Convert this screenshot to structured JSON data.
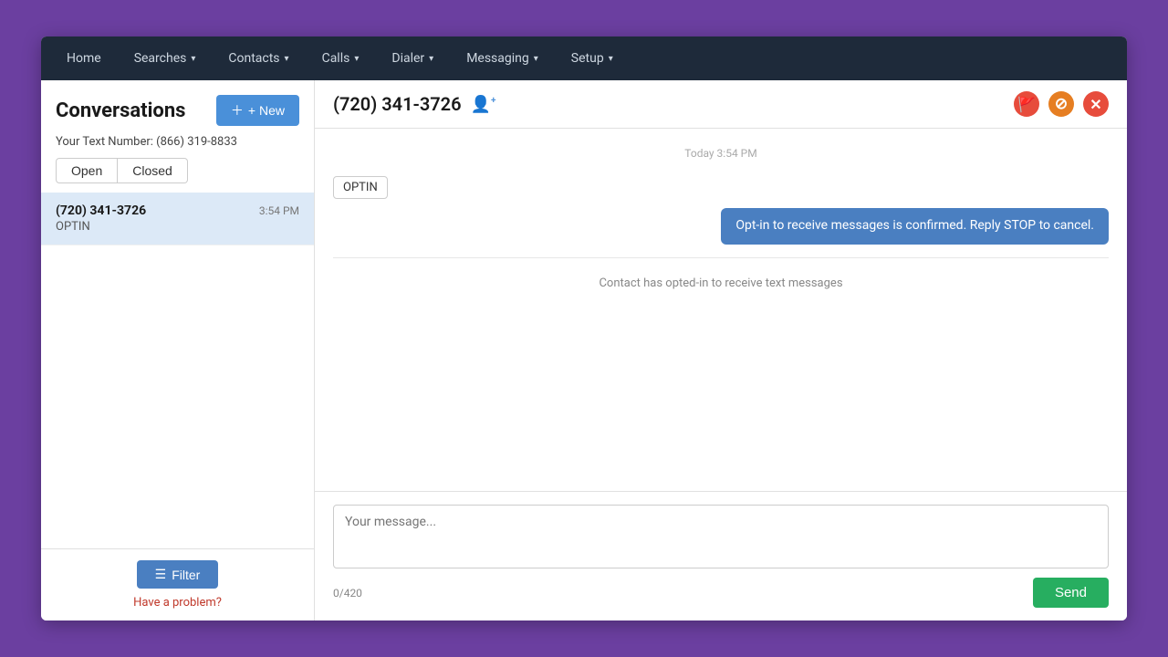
{
  "nav": {
    "items": [
      {
        "label": "Home",
        "has_dropdown": false
      },
      {
        "label": "Searches",
        "has_dropdown": true
      },
      {
        "label": "Contacts",
        "has_dropdown": true
      },
      {
        "label": "Calls",
        "has_dropdown": true
      },
      {
        "label": "Dialer",
        "has_dropdown": true
      },
      {
        "label": "Messaging",
        "has_dropdown": true
      },
      {
        "label": "Setup",
        "has_dropdown": true
      }
    ]
  },
  "sidebar": {
    "title": "Conversations",
    "new_button_label": "+ New",
    "text_number_label": "Your Text Number: (866) 319-8833",
    "tabs": [
      {
        "label": "Open",
        "active": true
      },
      {
        "label": "Closed",
        "active": false
      }
    ],
    "conversations": [
      {
        "phone": "(720) 341-3726",
        "time": "3:54 PM",
        "label": "OPTIN",
        "selected": true
      }
    ],
    "filter_button_label": "Filter",
    "problem_link_label": "Have a problem?"
  },
  "chat": {
    "phone": "(720) 341-3726",
    "time_label": "Today 3:54 PM",
    "optin_badge": "OPTIN",
    "outgoing_message": "Opt-in to receive messages is confirmed. Reply STOP to cancel.",
    "optin_confirm_text": "Contact has opted-in to receive text messages",
    "message_placeholder": "Your message...",
    "char_count": "0/420",
    "send_button_label": "Send",
    "icons": {
      "flag": "🚩",
      "cancel": "⊘",
      "close": "✕",
      "add_contact": "👤+"
    }
  }
}
